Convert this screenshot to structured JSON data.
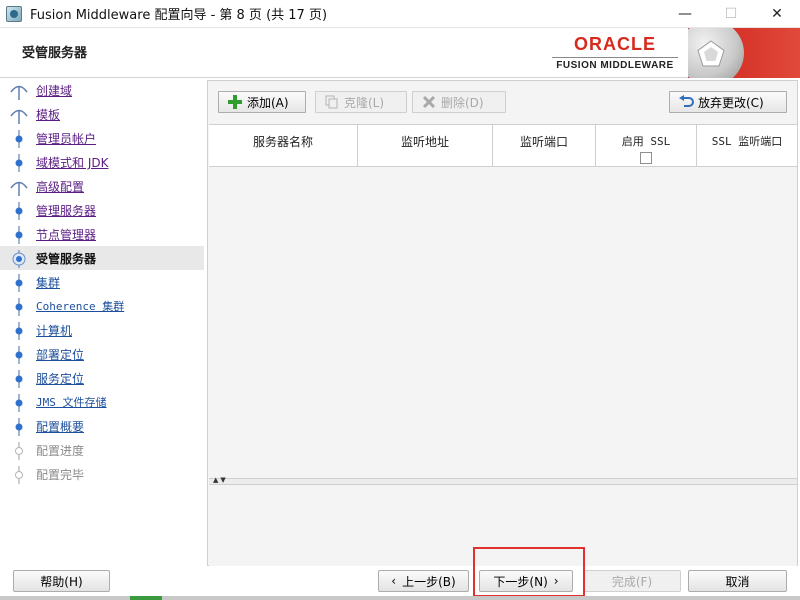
{
  "window": {
    "title": "Fusion Middleware 配置向导 - 第 8 页 (共 17 页)",
    "controls": {
      "minimize": "—",
      "maximize": "☐",
      "close": "✕"
    }
  },
  "header": {
    "page_title": "受管服务器",
    "logo_brand": "ORACLE",
    "logo_product": "FUSION MIDDLEWARE"
  },
  "steps": [
    {
      "label": "创建域",
      "state": "completed",
      "icon": "completed-step-icon"
    },
    {
      "label": "模板",
      "state": "completed",
      "icon": "completed-step-icon"
    },
    {
      "label": "管理员帐户",
      "state": "completed",
      "icon": "step-dot-icon"
    },
    {
      "label": "域模式和 JDK",
      "state": "completed",
      "icon": "step-dot-icon"
    },
    {
      "label": "高级配置",
      "state": "completed",
      "icon": "completed-step-icon"
    },
    {
      "label": "管理服务器",
      "state": "completed",
      "icon": "step-dot-icon"
    },
    {
      "label": "节点管理器",
      "state": "completed",
      "icon": "step-dot-icon"
    },
    {
      "label": "受管服务器",
      "state": "current",
      "icon": "current-step-icon"
    },
    {
      "label": "集群",
      "state": "future",
      "icon": "step-dot-icon"
    },
    {
      "label": "Coherence 集群",
      "state": "future",
      "icon": "step-dot-icon"
    },
    {
      "label": "计算机",
      "state": "future",
      "icon": "step-dot-icon"
    },
    {
      "label": "部署定位",
      "state": "future",
      "icon": "step-dot-icon"
    },
    {
      "label": "服务定位",
      "state": "future",
      "icon": "step-dot-icon"
    },
    {
      "label": "JMS 文件存储",
      "state": "future",
      "icon": "step-dot-icon"
    },
    {
      "label": "配置概要",
      "state": "future",
      "icon": "step-dot-icon"
    },
    {
      "label": "配置进度",
      "state": "disabled",
      "icon": "step-empty-dot-icon"
    },
    {
      "label": "配置完毕",
      "state": "disabled",
      "icon": "step-empty-dot-icon"
    }
  ],
  "toolbar": {
    "add_label": "添加(A)",
    "clone_label": "克隆(L)",
    "delete_label": "删除(D)",
    "discard_label": "放弃更改(C)"
  },
  "table": {
    "columns": [
      "服务器名称",
      "监听地址",
      "监听端口",
      "启用 SSL",
      "SSL 监听端口"
    ],
    "rows": []
  },
  "footer": {
    "help_label": "帮助(H)",
    "back_label": "上一步(B)",
    "next_label": "下一步(N)",
    "finish_label": "完成(F)",
    "cancel_label": "取消"
  },
  "colors": {
    "oracle_red": "#d52b1e",
    "link_visited": "#5b1d84",
    "link_future": "#1c4f9c",
    "highlight": "#e0312f"
  }
}
